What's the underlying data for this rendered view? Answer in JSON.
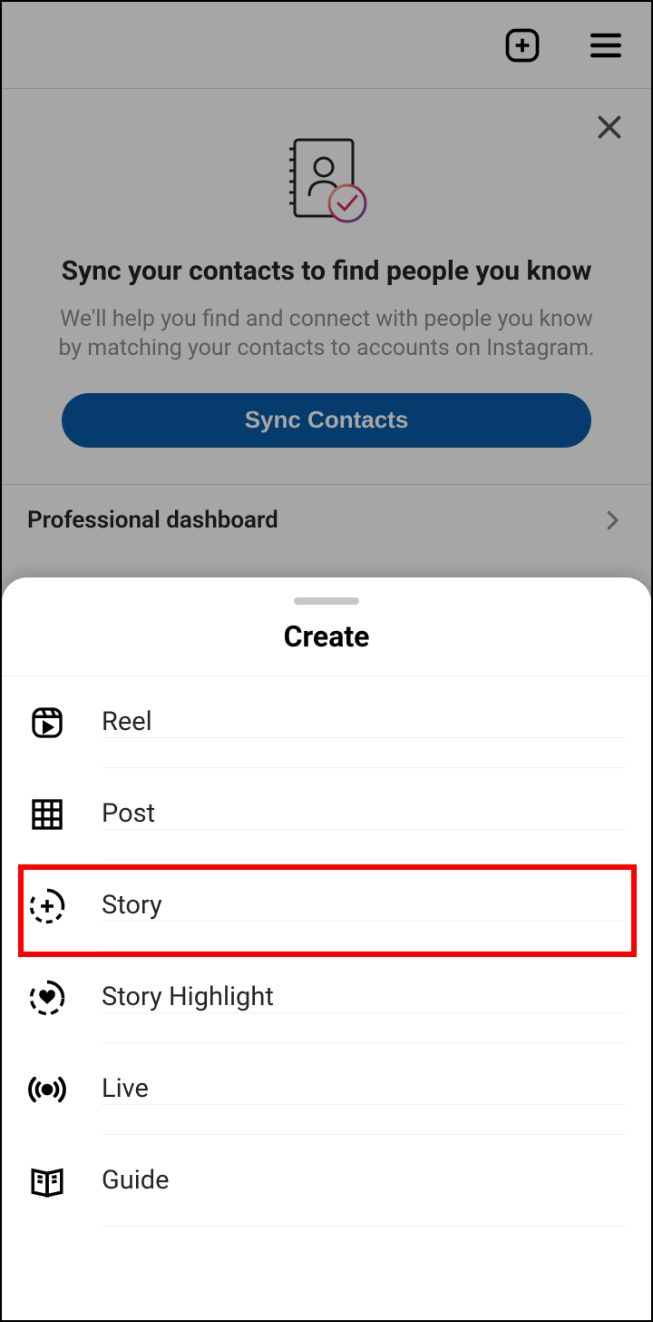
{
  "topbar": {
    "create_icon": "plus-square",
    "menu_icon": "hamburger"
  },
  "sync": {
    "title": "Sync your contacts to find people you know",
    "description": "We'll help you find and connect with people you know by matching your contacts to accounts on Instagram.",
    "button_label": "Sync Contacts"
  },
  "pro_dashboard": {
    "title": "Professional dashboard"
  },
  "sheet": {
    "title": "Create",
    "items": [
      {
        "label": "Reel",
        "icon": "reel"
      },
      {
        "label": "Post",
        "icon": "grid"
      },
      {
        "label": "Story",
        "icon": "story-plus"
      },
      {
        "label": "Story Highlight",
        "icon": "story-heart"
      },
      {
        "label": "Live",
        "icon": "live"
      },
      {
        "label": "Guide",
        "icon": "guide"
      }
    ]
  },
  "highlight": {
    "index": 2
  }
}
